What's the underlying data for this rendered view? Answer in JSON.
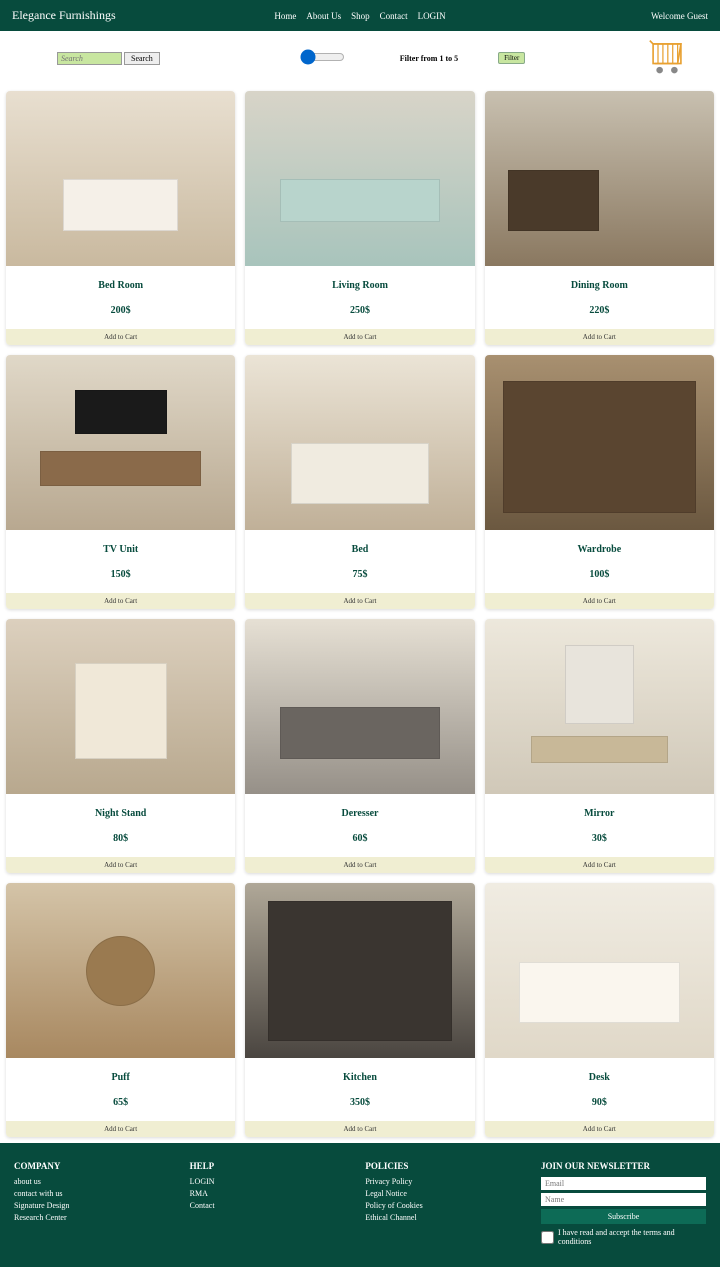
{
  "brand": "Elegance Furnishings",
  "nav": {
    "home": "Home",
    "about": "About Us",
    "shop": "Shop",
    "contact": "Contact",
    "login": "LOGIN"
  },
  "welcome": "Welcome Guest",
  "search": {
    "placeholder": "Search",
    "button": "Search"
  },
  "filter": {
    "text": "Filter from 1 to 5",
    "button": "Filter"
  },
  "add_label": "Add to Cart",
  "products": [
    {
      "name": "Bed Room",
      "price": "200$"
    },
    {
      "name": "Living Room",
      "price": "250$"
    },
    {
      "name": "Dining Room",
      "price": "220$"
    },
    {
      "name": "TV Unit",
      "price": "150$"
    },
    {
      "name": "Bed",
      "price": "75$"
    },
    {
      "name": "Wardrobe",
      "price": "100$"
    },
    {
      "name": "Night Stand",
      "price": "80$"
    },
    {
      "name": "Deresser",
      "price": "60$"
    },
    {
      "name": "Mirror",
      "price": "30$"
    },
    {
      "name": "Puff",
      "price": "65$"
    },
    {
      "name": "Kitchen",
      "price": "350$"
    },
    {
      "name": "Desk",
      "price": "90$"
    }
  ],
  "footer": {
    "company": {
      "title": "COMPANY",
      "items": [
        "about us",
        "contact with us",
        "Signature Design",
        "Research Center"
      ]
    },
    "help": {
      "title": "HELP",
      "items": [
        "LOGIN",
        "RMA",
        "Contact"
      ]
    },
    "policies": {
      "title": "POLICIES",
      "items": [
        "Privacy Policy",
        "Legal Notice",
        "Policy of Cookies",
        "Ethical Channel"
      ]
    },
    "newsletter": {
      "title": "JOIN OUR NEWSLETTER",
      "email_ph": "Email",
      "name_ph": "Name",
      "subscribe": "Subscribe",
      "terms": "I have read and accept the terms and conditions"
    }
  }
}
